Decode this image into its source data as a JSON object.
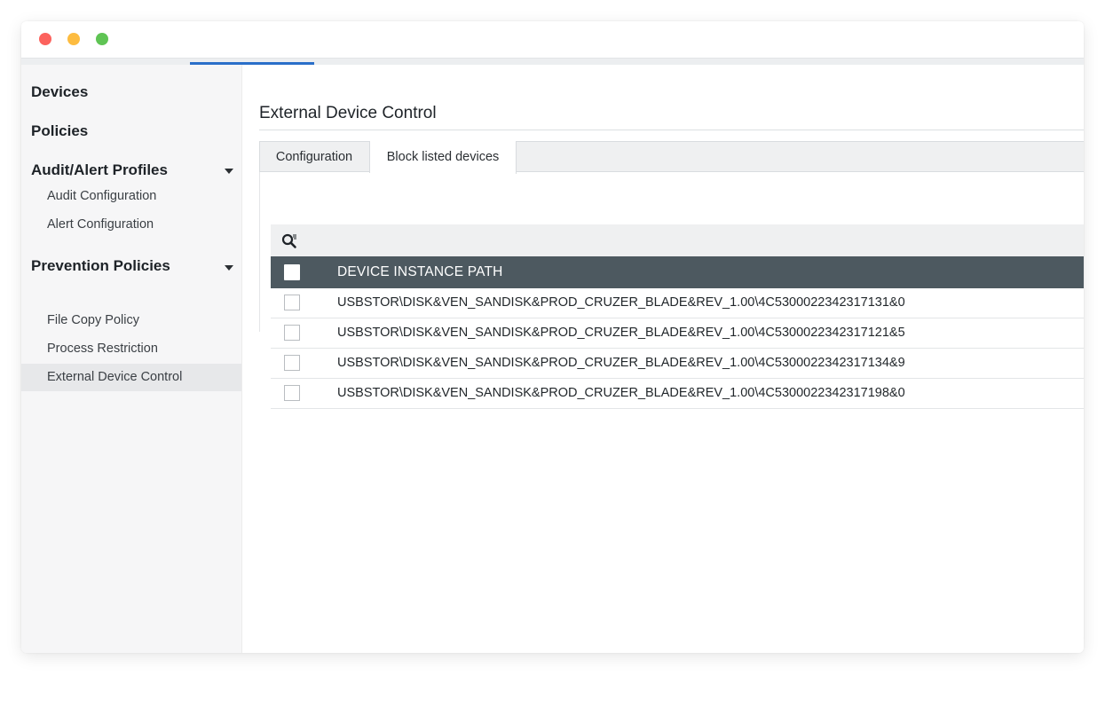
{
  "window": {
    "controls": [
      "close",
      "minimize",
      "maximize"
    ]
  },
  "sidebar": {
    "groups": [
      {
        "label": "Devices"
      },
      {
        "label": "Policies"
      },
      {
        "label": "Audit/Alert Profiles",
        "expanded": true,
        "items": [
          {
            "label": "Audit Configuration"
          },
          {
            "label": "Alert Configuration"
          }
        ]
      },
      {
        "label": "Prevention Policies",
        "expanded": true,
        "items": [
          {
            "label": "File Copy Policy"
          },
          {
            "label": "Process Restriction"
          },
          {
            "label": "External Device Control",
            "active": true
          }
        ]
      }
    ]
  },
  "main": {
    "title": "External Device Control",
    "tabs": [
      {
        "label": "Configuration",
        "active": false
      },
      {
        "label": "Block listed devices",
        "active": true
      }
    ],
    "toolbar": {
      "search_icon": "search-icon"
    },
    "grid": {
      "columns": [
        "DEVICE INSTANCE PATH"
      ],
      "rows": [
        "USBSTOR\\DISK&VEN_SANDISK&PROD_CRUZER_BLADE&REV_1.00\\4C530002234231713​1&0",
        "USBSTOR\\DISK&VEN_SANDISK&PROD_CRUZER_BLADE&REV_1.00\\4C530002234231712​1&5",
        "USBSTOR\\DISK&VEN_SANDISK&PROD_CRUZER_BLADE&REV_1.00\\4C530002234231713​4&9",
        "USBSTOR\\DISK&VEN_SANDISK&PROD_CRUZER_BLADE&REV_1.00\\4C530002234231719​8&0"
      ]
    }
  },
  "colors": {
    "accent": "#2a6fc9",
    "grid_header_bg": "#4d5960",
    "sidebar_bg": "#f6f6f7",
    "active_item_bg": "#e7e8ea"
  }
}
